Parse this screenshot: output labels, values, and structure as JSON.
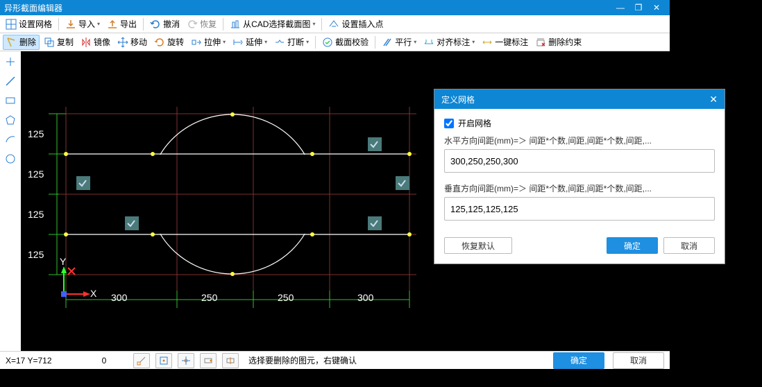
{
  "window": {
    "title": "异形截面编辑器"
  },
  "menubar": {
    "set_grid": "设置网格",
    "import": "导入",
    "export": "导出",
    "undo": "撤消",
    "redo": "恢复",
    "from_cad": "从CAD选择截面图",
    "set_insert": "设置插入点"
  },
  "toolbar": {
    "delete": "删除",
    "copy": "复制",
    "mirror": "镜像",
    "move": "移动",
    "rotate": "旋转",
    "stretch": "拉伸",
    "extend": "延伸",
    "break": "打断",
    "section_check": "截面校验",
    "parallel": "平行",
    "align_dim": "对齐标注",
    "one_key_dim": "一键标注",
    "del_constraint": "删除约束"
  },
  "canvas": {
    "row_labels": [
      "125",
      "125",
      "125",
      "125"
    ],
    "col_labels": [
      "300",
      "250",
      "250",
      "300"
    ],
    "axis": {
      "x": "X",
      "y": "Y"
    }
  },
  "chart_data": {
    "type": "table",
    "title": "Grid spacing",
    "horizontal_spacing_mm": [
      300,
      250,
      250,
      300
    ],
    "vertical_spacing_mm": [
      125,
      125,
      125,
      125
    ]
  },
  "status": {
    "coord": "X=17 Y=712",
    "zero": "0",
    "hint": "选择要删除的图元，右键确认",
    "ok": "确定",
    "cancel": "取消"
  },
  "dialog": {
    "title": "定义网格",
    "enable_label": "开启网格",
    "horiz_label": "水平方向间距(mm)=＞ 间距*个数,间距,间距*个数,间距,...",
    "horiz_value": "300,250,250,300",
    "vert_label": "垂直方向间距(mm)=＞ 间距*个数,间距,间距*个数,间距,...",
    "vert_value": "125,125,125,125",
    "restore": "恢复默认",
    "ok": "确定",
    "cancel": "取消"
  },
  "icons": {
    "grid": "grid-icon",
    "import": "import-icon",
    "export": "export-icon",
    "undo": "undo-icon",
    "redo": "redo-icon",
    "cad": "cad-icon",
    "insert": "insert-icon",
    "delete": "delete-icon",
    "copy": "copy-icon",
    "mirror": "mirror-icon",
    "move": "move-icon",
    "rotate": "rotate-icon",
    "stretch": "stretch-icon",
    "extend": "extend-icon",
    "break": "break-icon",
    "check": "check-icon",
    "parallel": "parallel-icon",
    "align": "align-icon",
    "onekey": "onekey-icon",
    "delcon": "delcon-icon",
    "point": "point-icon",
    "line": "line-icon",
    "rect": "rect-icon",
    "poly": "poly-icon",
    "arc": "arc-icon",
    "circle": "circle-icon",
    "text": "text-icon"
  }
}
